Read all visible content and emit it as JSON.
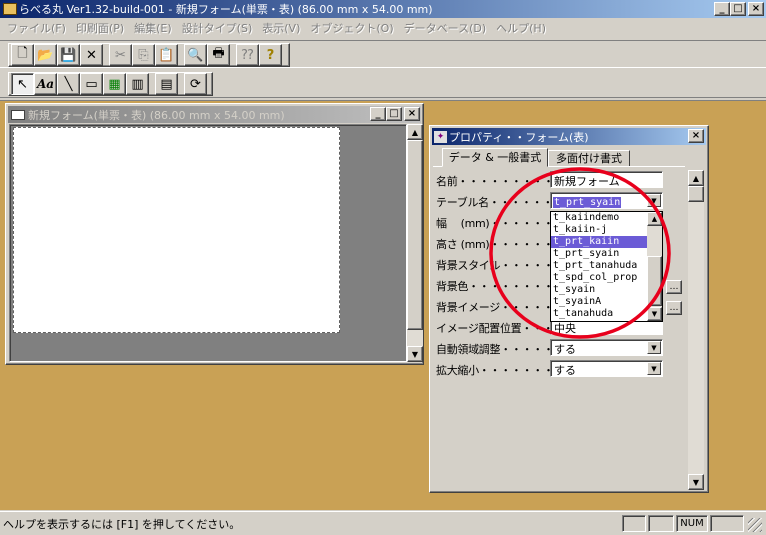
{
  "app": {
    "title": "らべる丸 Ver1.32-build-001 - 新規フォーム(単票・表) (86.00 mm x 54.00 mm)"
  },
  "menu": [
    "ファイル(F)",
    "印刷面(P)",
    "編集(E)",
    "設計タイプ(S)",
    "表示(V)",
    "オブジェクト(O)",
    "データベース(D)",
    "ヘルプ(H)"
  ],
  "toolbar1": [
    "new-icon",
    "open-icon",
    "save-icon",
    "delete-icon",
    "cut-icon",
    "copy-icon",
    "paste-icon",
    "print-preview-icon",
    "print-icon",
    "help-context-icon",
    "help-icon"
  ],
  "toolbar2": [
    "pointer-icon",
    "text-icon",
    "line-icon",
    "rectangle-icon",
    "image-icon",
    "barcode-icon",
    "table-icon",
    "refresh-icon"
  ],
  "doc": {
    "title": "新規フォーム(単票・表) (86.00 mm x 54.00 mm)"
  },
  "props": {
    "title": "プロパティ・・フォーム(表)",
    "tabs": [
      "データ & 一般書式",
      "多面付け書式"
    ],
    "rows": [
      {
        "label": "名前・・・・・・・・・・・・・",
        "value": "新規フォーム"
      },
      {
        "label": "テーブル名・・・・・・・・・",
        "value": "t_prt_syain"
      },
      {
        "label": "幅 　(mm)・・・・・・・",
        "value": ""
      },
      {
        "label": "高さ (mm)・・・・・・・",
        "value": ""
      },
      {
        "label": "背景スタイル・・・・・・・",
        "value": ""
      },
      {
        "label": "背景色・・・・・・・・・・・",
        "value": ""
      },
      {
        "label": "背景イメージ・・・・・・・",
        "value": ""
      },
      {
        "label": "イメージ配置位置・・・・",
        "value": "中央"
      },
      {
        "label": "自動領域調整・・・・・・",
        "value": "する"
      },
      {
        "label": "拡大縮小・・・・・・・・・",
        "value": "する"
      }
    ],
    "dropdown": {
      "items": [
        "t_kaiindemo",
        "t_kaiin-j",
        "t_prt_kaiin",
        "t_prt_syain",
        "t_prt_tanahuda",
        "t_spd_col_prop",
        "t_syain",
        "t_syainA",
        "t_tanahuda"
      ],
      "selected": "t_prt_kaiin"
    }
  },
  "status": {
    "help_text": "ヘルプを表示するには [F1] を押してください。",
    "num": "NUM"
  },
  "colors": {
    "workspace": "#c9a155",
    "titlebar": "#0a246a",
    "selection": "#6b5bd6",
    "annotation_circle": "#e8001c"
  }
}
